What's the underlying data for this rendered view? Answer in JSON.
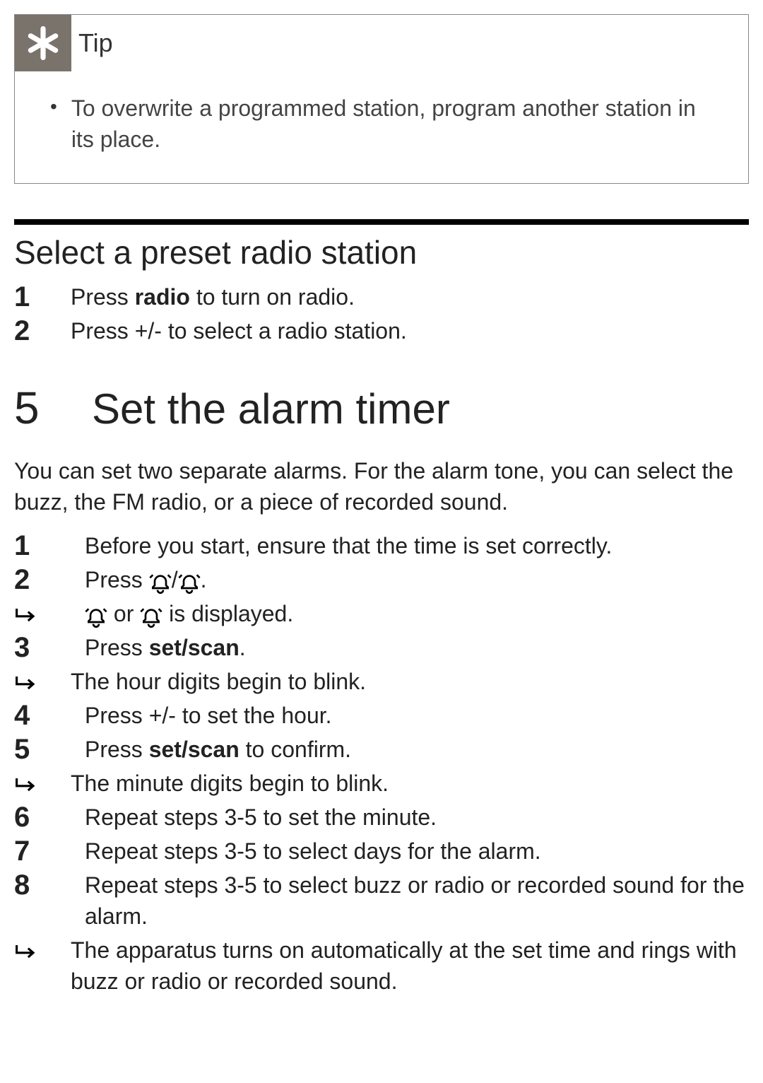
{
  "tip": {
    "title": "Tip",
    "bullet_text": "To overwrite a programmed station, program another station in its place."
  },
  "section1": {
    "heading": "Select a preset radio station",
    "steps": [
      {
        "num": "1",
        "pre": "Press ",
        "bold": "radio",
        "post": " to turn on radio."
      },
      {
        "num": "2",
        "pre": "Press +/- to select a radio station.",
        "bold": "",
        "post": ""
      }
    ]
  },
  "chapter": {
    "num": "5",
    "title": "Set the alarm timer"
  },
  "intro": "You can set two separate alarms. For the alarm tone, you can select the buzz, the FM radio, or a piece of recorded sound.",
  "section2": {
    "items": [
      {
        "type": "step",
        "num": "1",
        "text": "Before you start, ensure that the time is set correctly."
      },
      {
        "type": "step_icons",
        "num": "2",
        "pre": "Press ",
        "mid": "/",
        "post": "."
      },
      {
        "type": "sub_icons",
        "mid": " or ",
        "post": " is displayed."
      },
      {
        "type": "step_bold",
        "num": "3",
        "pre": "Press ",
        "bold": "set/scan",
        "post": "."
      },
      {
        "type": "sub_text",
        "text": "The hour digits begin to blink."
      },
      {
        "type": "step",
        "num": "4",
        "text": "Press +/- to set the hour."
      },
      {
        "type": "step_bold",
        "num": "5",
        "pre": "Press ",
        "bold": "set/scan",
        "post": " to confirm."
      },
      {
        "type": "sub_text",
        "text": "The minute digits begin to blink."
      },
      {
        "type": "step",
        "num": "6",
        "text": "Repeat steps 3-5 to set the minute."
      },
      {
        "type": "step",
        "num": "7",
        "text": "Repeat steps 3-5 to select days for the alarm."
      },
      {
        "type": "step",
        "num": "8",
        "text": "Repeat steps 3-5 to select buzz or radio or recorded sound for the alarm."
      },
      {
        "type": "sub_text",
        "text": "The apparatus turns on automatically at the set time and rings with buzz or radio or recorded sound."
      }
    ]
  }
}
